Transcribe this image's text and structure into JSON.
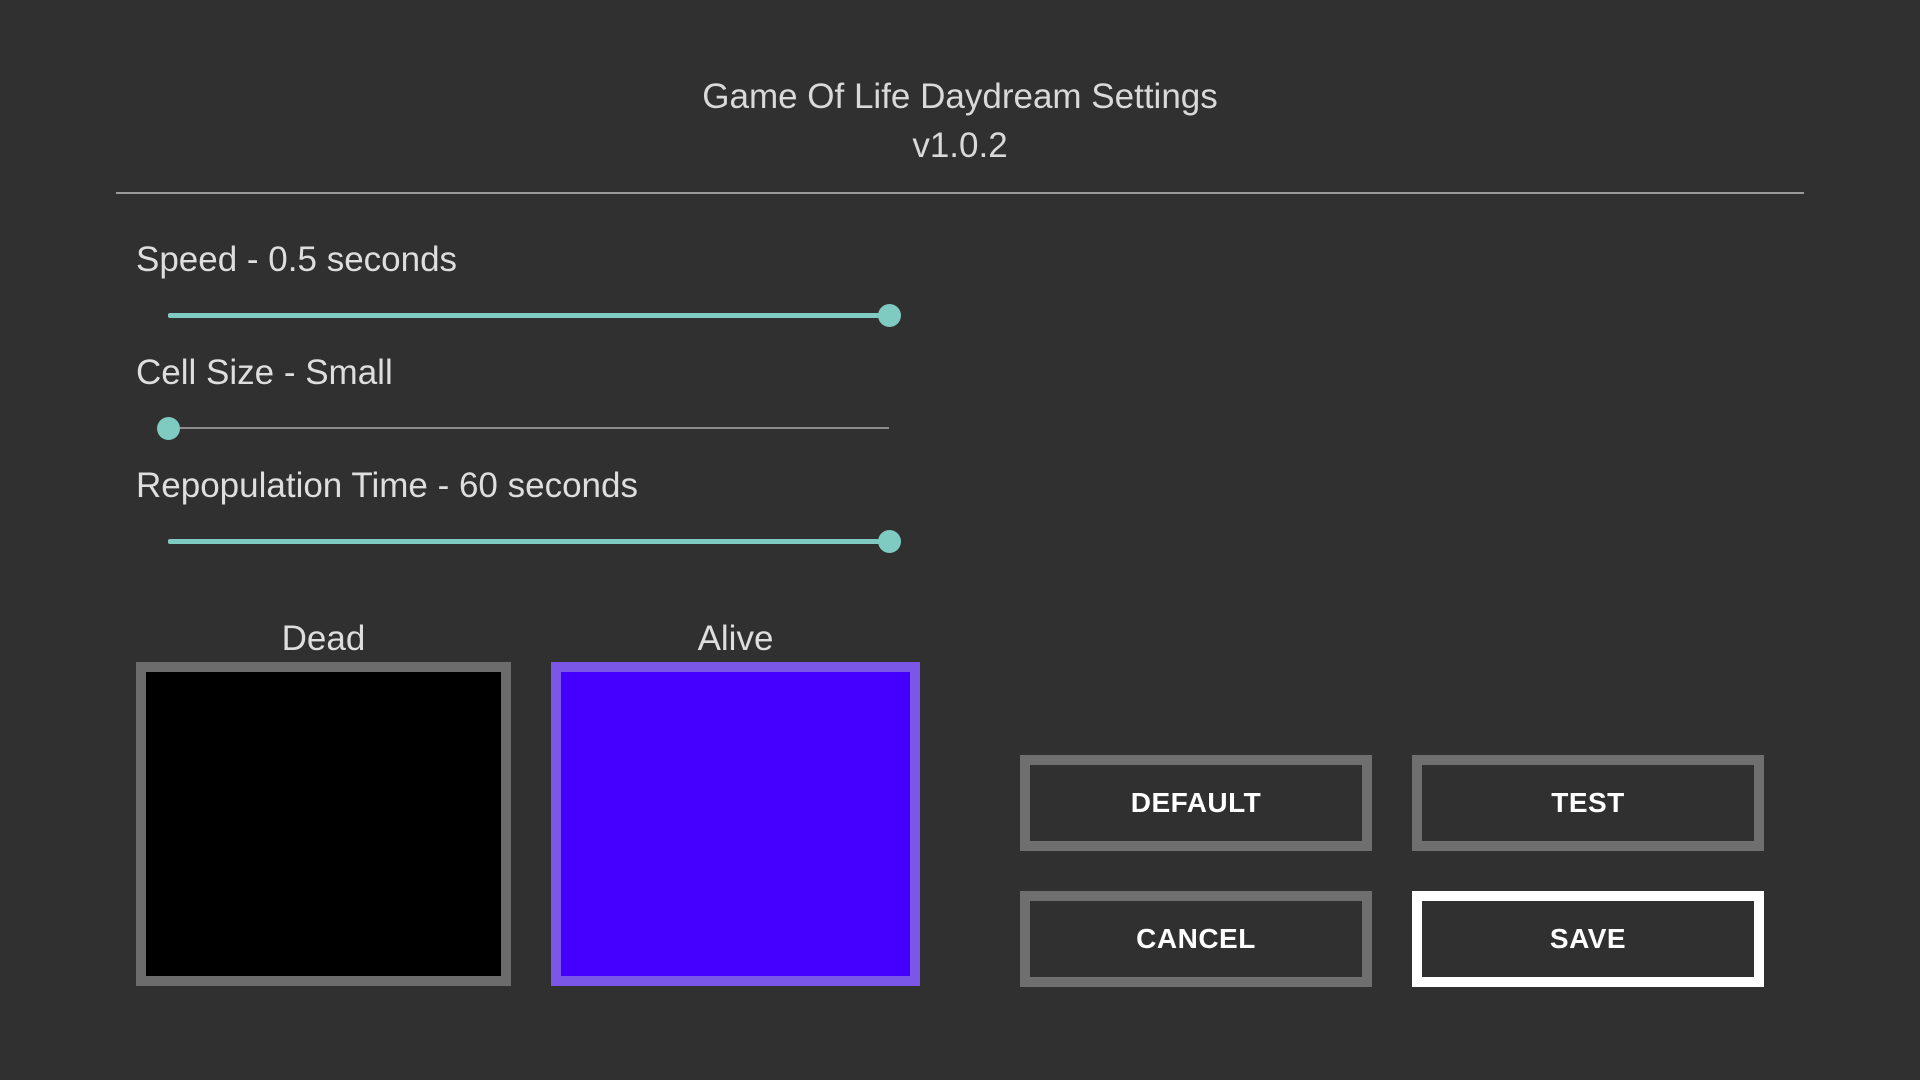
{
  "header": {
    "title": "Game Of Life Daydream Settings",
    "version": "v1.0.2"
  },
  "settings": {
    "speed": {
      "label": "Speed - 0.5 seconds",
      "level": 1.0
    },
    "cell_size": {
      "label": "Cell Size - Small",
      "level": 0.0
    },
    "repopulation": {
      "label": "Repopulation Time - 60 seconds",
      "level": 1.0
    }
  },
  "colors": {
    "dead": {
      "label": "Dead",
      "fill": "#000000",
      "border": "#6c6c6c"
    },
    "alive": {
      "label": "Alive",
      "fill": "#4400ff",
      "border": "#7b57e8"
    },
    "accent": "#7fcbc2"
  },
  "buttons": {
    "default_label": "DEFAULT",
    "test_label": "TEST",
    "cancel_label": "CANCEL",
    "save_label": "SAVE"
  }
}
